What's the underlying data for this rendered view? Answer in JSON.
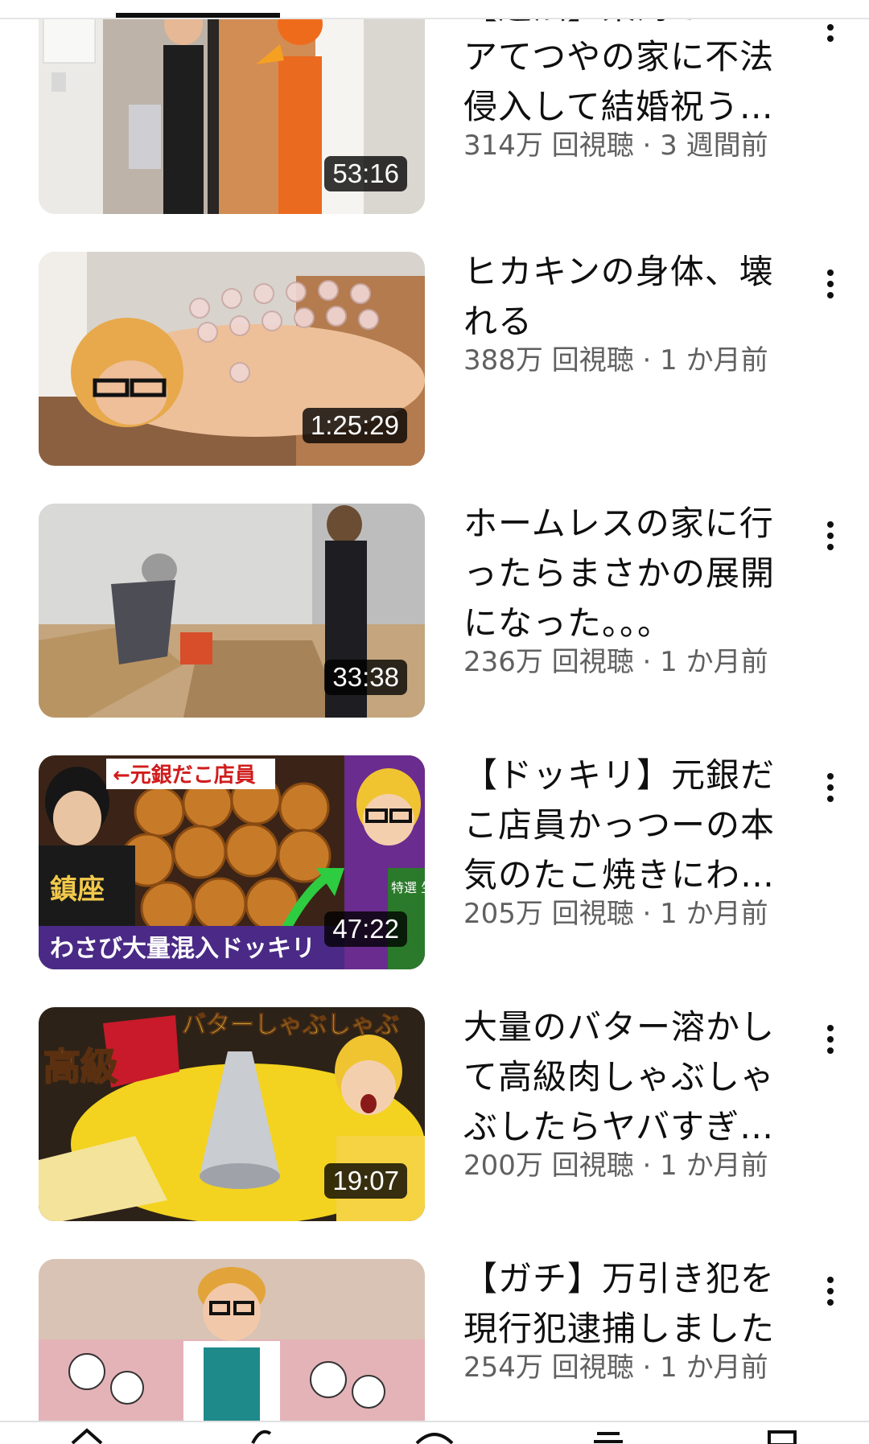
{
  "videos": [
    {
      "title": "【違法】東海オンエアてつやの家に不法侵入して結婚祝うド…",
      "meta": "314万 回視聴 · 3 週間前",
      "duration": "53:16",
      "thumbnail": "two-men-at-doorway"
    },
    {
      "title": "ヒカキンの身体、壊れる",
      "meta": "388万 回視聴 · 1 か月前",
      "duration": "1:25:29",
      "thumbnail": "cupping-therapy"
    },
    {
      "title": "ホームレスの家に行ったらまさかの展開になった。。。",
      "meta": "236万 回視聴 · 1 か月前",
      "duration": "33:38",
      "thumbnail": "cardboard-room"
    },
    {
      "title": "【ドッキリ】元銀だこ店員かっつーの本気のたこ焼きにわさ…",
      "meta": "205万 回視聴 · 1 か月前",
      "duration": "47:22",
      "thumbnail": "takoyaki",
      "overlay": {
        "top_caption": "←元銀だこ店員",
        "shirt_text": "鎮座",
        "bottom_caption": "わさび大量混入ドッキリ",
        "package_text": "特選 生わさび"
      }
    },
    {
      "title": "大量のバター溶かして高級肉しゃぶしゃぶしたらヤバすぎた…",
      "meta": "200万 回視聴 · 1 か月前",
      "duration": "19:07",
      "thumbnail": "butter-shabu",
      "overlay": {
        "top_caption": "バターしゃぶしゃぶ",
        "side_caption": "高級"
      }
    },
    {
      "title": "【ガチ】万引き犯を現行犯逮捕しました",
      "meta": "254万 回視聴 · 1 か月前",
      "duration": "",
      "thumbnail": "man-on-sofa"
    }
  ],
  "colors": {
    "title": "#0f0f0f",
    "meta": "#606060",
    "duration_bg": "#000000cc",
    "duration_text": "#ffffff"
  },
  "icons": {
    "menu": "more-vert-icon",
    "nav": [
      "home-icon",
      "shorts-icon",
      "create-icon",
      "subscriptions-icon",
      "library-icon"
    ]
  }
}
